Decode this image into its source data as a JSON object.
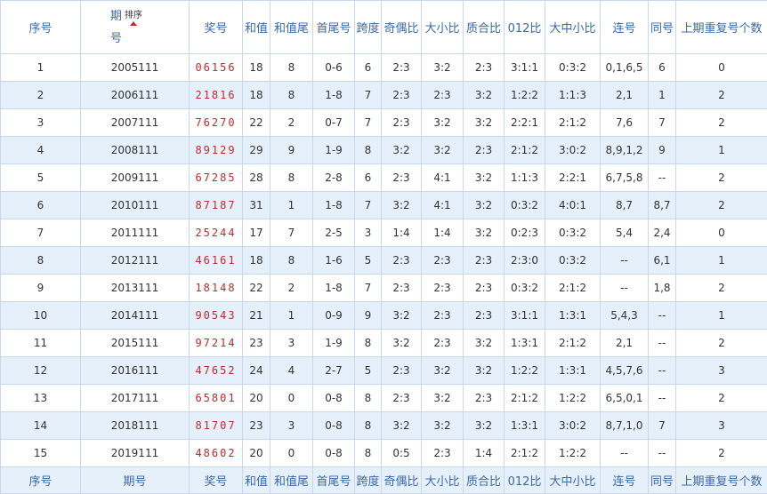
{
  "header": {
    "seq": "序号",
    "period": "期号",
    "sort_label": "排序",
    "prize": "奖号",
    "sum": "和值",
    "sum_tail": "和值尾",
    "first_last": "首尾号",
    "span": "跨度",
    "odd_even": "奇偶比",
    "big_small": "大小比",
    "prime_composite": "质合比",
    "r012": "012比",
    "big_mid_small": "大中小比",
    "consecutive": "连号",
    "same": "同号",
    "repeat_prev": "上期重复号个数"
  },
  "rows": [
    {
      "seq": "1",
      "period": "2005111",
      "prize": "06156",
      "sum": "18",
      "sum_tail": "8",
      "first_last": "0-6",
      "span": "6",
      "odd_even": "2:3",
      "big_small": "3:2",
      "prime_composite": "2:3",
      "r012": "3:1:1",
      "big_mid_small": "0:3:2",
      "consecutive": "0,1,6,5",
      "same": "6",
      "repeat_prev": "0"
    },
    {
      "seq": "2",
      "period": "2006111",
      "prize": "21816",
      "sum": "18",
      "sum_tail": "8",
      "first_last": "1-8",
      "span": "7",
      "odd_even": "2:3",
      "big_small": "2:3",
      "prime_composite": "3:2",
      "r012": "1:2:2",
      "big_mid_small": "1:1:3",
      "consecutive": "2,1",
      "same": "1",
      "repeat_prev": "2"
    },
    {
      "seq": "3",
      "period": "2007111",
      "prize": "76270",
      "sum": "22",
      "sum_tail": "2",
      "first_last": "0-7",
      "span": "7",
      "odd_even": "2:3",
      "big_small": "3:2",
      "prime_composite": "3:2",
      "r012": "2:2:1",
      "big_mid_small": "2:1:2",
      "consecutive": "7,6",
      "same": "7",
      "repeat_prev": "2"
    },
    {
      "seq": "4",
      "period": "2008111",
      "prize": "89129",
      "sum": "29",
      "sum_tail": "9",
      "first_last": "1-9",
      "span": "8",
      "odd_even": "3:2",
      "big_small": "3:2",
      "prime_composite": "2:3",
      "r012": "2:1:2",
      "big_mid_small": "3:0:2",
      "consecutive": "8,9,1,2",
      "same": "9",
      "repeat_prev": "1"
    },
    {
      "seq": "5",
      "period": "2009111",
      "prize": "67285",
      "sum": "28",
      "sum_tail": "8",
      "first_last": "2-8",
      "span": "6",
      "odd_even": "2:3",
      "big_small": "4:1",
      "prime_composite": "3:2",
      "r012": "1:1:3",
      "big_mid_small": "2:2:1",
      "consecutive": "6,7,5,8",
      "same": "--",
      "repeat_prev": "2"
    },
    {
      "seq": "6",
      "period": "2010111",
      "prize": "87187",
      "sum": "31",
      "sum_tail": "1",
      "first_last": "1-8",
      "span": "7",
      "odd_even": "3:2",
      "big_small": "4:1",
      "prime_composite": "3:2",
      "r012": "0:3:2",
      "big_mid_small": "4:0:1",
      "consecutive": "8,7",
      "same": "8,7",
      "repeat_prev": "2"
    },
    {
      "seq": "7",
      "period": "2011111",
      "prize": "25244",
      "sum": "17",
      "sum_tail": "7",
      "first_last": "2-5",
      "span": "3",
      "odd_even": "1:4",
      "big_small": "1:4",
      "prime_composite": "3:2",
      "r012": "0:2:3",
      "big_mid_small": "0:3:2",
      "consecutive": "5,4",
      "same": "2,4",
      "repeat_prev": "0"
    },
    {
      "seq": "8",
      "period": "2012111",
      "prize": "46161",
      "sum": "18",
      "sum_tail": "8",
      "first_last": "1-6",
      "span": "5",
      "odd_even": "2:3",
      "big_small": "2:3",
      "prime_composite": "2:3",
      "r012": "2:3:0",
      "big_mid_small": "0:3:2",
      "consecutive": "--",
      "same": "6,1",
      "repeat_prev": "1"
    },
    {
      "seq": "9",
      "period": "2013111",
      "prize": "18148",
      "sum": "22",
      "sum_tail": "2",
      "first_last": "1-8",
      "span": "7",
      "odd_even": "2:3",
      "big_small": "2:3",
      "prime_composite": "2:3",
      "r012": "0:3:2",
      "big_mid_small": "2:1:2",
      "consecutive": "--",
      "same": "1,8",
      "repeat_prev": "2"
    },
    {
      "seq": "10",
      "period": "2014111",
      "prize": "90543",
      "sum": "21",
      "sum_tail": "1",
      "first_last": "0-9",
      "span": "9",
      "odd_even": "3:2",
      "big_small": "2:3",
      "prime_composite": "2:3",
      "r012": "3:1:1",
      "big_mid_small": "1:3:1",
      "consecutive": "5,4,3",
      "same": "--",
      "repeat_prev": "1"
    },
    {
      "seq": "11",
      "period": "2015111",
      "prize": "97214",
      "sum": "23",
      "sum_tail": "3",
      "first_last": "1-9",
      "span": "8",
      "odd_even": "3:2",
      "big_small": "2:3",
      "prime_composite": "3:2",
      "r012": "1:3:1",
      "big_mid_small": "2:1:2",
      "consecutive": "2,1",
      "same": "--",
      "repeat_prev": "2"
    },
    {
      "seq": "12",
      "period": "2016111",
      "prize": "47652",
      "sum": "24",
      "sum_tail": "4",
      "first_last": "2-7",
      "span": "5",
      "odd_even": "2:3",
      "big_small": "3:2",
      "prime_composite": "3:2",
      "r012": "1:2:2",
      "big_mid_small": "1:3:1",
      "consecutive": "4,5,7,6",
      "same": "--",
      "repeat_prev": "3"
    },
    {
      "seq": "13",
      "period": "2017111",
      "prize": "65801",
      "sum": "20",
      "sum_tail": "0",
      "first_last": "0-8",
      "span": "8",
      "odd_even": "2:3",
      "big_small": "3:2",
      "prime_composite": "2:3",
      "r012": "2:1:2",
      "big_mid_small": "1:2:2",
      "consecutive": "6,5,0,1",
      "same": "--",
      "repeat_prev": "2"
    },
    {
      "seq": "14",
      "period": "2018111",
      "prize": "81707",
      "sum": "23",
      "sum_tail": "3",
      "first_last": "0-8",
      "span": "8",
      "odd_even": "3:2",
      "big_small": "3:2",
      "prime_composite": "3:2",
      "r012": "1:3:1",
      "big_mid_small": "3:0:2",
      "consecutive": "8,7,1,0",
      "same": "7",
      "repeat_prev": "3"
    },
    {
      "seq": "15",
      "period": "2019111",
      "prize": "48602",
      "sum": "20",
      "sum_tail": "0",
      "first_last": "0-8",
      "span": "8",
      "odd_even": "0:5",
      "big_small": "2:3",
      "prime_composite": "1:4",
      "r012": "2:1:2",
      "big_mid_small": "1:2:2",
      "consecutive": "--",
      "same": "--",
      "repeat_prev": "2"
    }
  ],
  "footer": {
    "seq": "序号",
    "period": "期号",
    "prize": "奖号",
    "sum": "和值",
    "sum_tail": "和值尾",
    "first_last": "首尾号",
    "span": "跨度",
    "odd_even": "奇偶比",
    "big_small": "大小比",
    "prime_composite": "质合比",
    "r012": "012比",
    "big_mid_small": "大中小比",
    "consecutive": "连号",
    "same": "同号",
    "repeat_prev": "上期重复号个数"
  },
  "colors": {
    "header_text": "#3b68a6",
    "prize_red": "#c0282e",
    "row_alt_bg": "#e6f0fb",
    "border": "#c9d8e8"
  }
}
